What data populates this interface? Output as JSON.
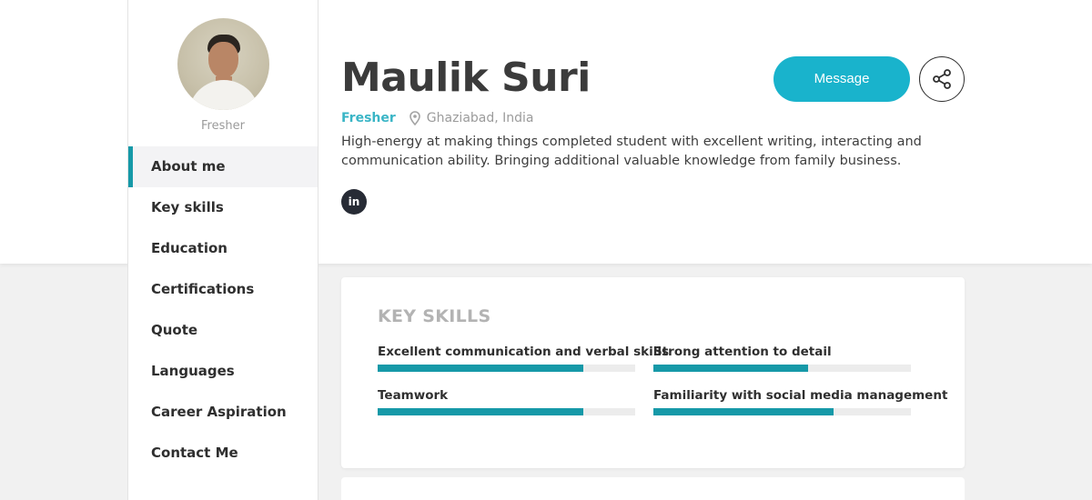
{
  "profile": {
    "name": "Maulik Suri",
    "role": "Fresher",
    "status": "Fresher",
    "location": "Ghaziabad, India",
    "bio": "High-energy at making things completed student with excellent writing, interacting and communication ability. Bringing additional valuable knowledge from family business.",
    "social": {
      "linkedin_label": "in"
    }
  },
  "actions": {
    "message_label": "Message",
    "share_icon": "share-icon"
  },
  "sidebar": {
    "items": [
      {
        "label": "About me",
        "active": true
      },
      {
        "label": "Key skills",
        "active": false
      },
      {
        "label": "Education",
        "active": false
      },
      {
        "label": "Certifications",
        "active": false
      },
      {
        "label": "Quote",
        "active": false
      },
      {
        "label": "Languages",
        "active": false
      },
      {
        "label": "Career Aspiration",
        "active": false
      },
      {
        "label": "Contact Me",
        "active": false
      }
    ]
  },
  "key_skills": {
    "title": "KEY SKILLS",
    "skills": [
      {
        "label": "Excellent communication and verbal skills",
        "level": 0.8
      },
      {
        "label": "Strong attention to detail",
        "level": 0.6
      },
      {
        "label": "Teamwork",
        "level": 0.8
      },
      {
        "label": "Familiarity with social media management",
        "level": 0.7
      }
    ]
  },
  "colors": {
    "accent": "#1699a8",
    "message_button": "#19b3cc",
    "status": "#3ab5c6"
  }
}
